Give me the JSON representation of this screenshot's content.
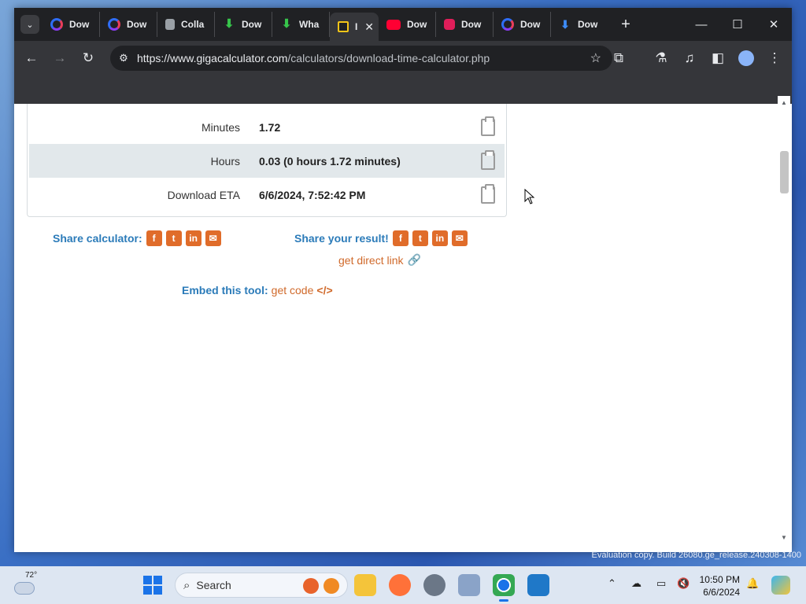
{
  "browser": {
    "tabs": [
      {
        "title": "Dow",
        "icon": "ring-logo-icon"
      },
      {
        "title": "Dow",
        "icon": "ring-logo-icon"
      },
      {
        "title": "Colla",
        "icon": "collab-icon"
      },
      {
        "title": "Dow",
        "icon": "download-arrow-icon"
      },
      {
        "title": "Wha",
        "icon": "download-arrow-icon"
      },
      {
        "title": "I",
        "icon": "gigacalculator-icon",
        "active": true
      },
      {
        "title": "Dow",
        "icon": "youtube-icon"
      },
      {
        "title": "Dow",
        "icon": "slack-icon"
      },
      {
        "title": "Dow",
        "icon": "ring-logo-icon"
      },
      {
        "title": "Dow",
        "icon": "blue-download-icon"
      }
    ],
    "tab_close_glyph": "✕",
    "new_tab_glyph": "+",
    "url_host": "https://www.gigacalculator.com",
    "url_path": "/calculators/download-time-calculator.php"
  },
  "results": {
    "rows": [
      {
        "label": "Minutes",
        "value": "1.72"
      },
      {
        "label": "Hours",
        "value": "0.03 (0 hours 1.72 minutes)"
      },
      {
        "label": "Download ETA",
        "value": "6/6/2024, 7:52:42 PM"
      }
    ]
  },
  "share": {
    "calculator_label": "Share calculator:",
    "result_label": "Share your result!",
    "direct_link": "get direct link",
    "embed_label": "Embed this tool:",
    "embed_link": "get code",
    "embed_glyph": "</>"
  },
  "desktop": {
    "watermark": "Evaluation copy. Build 26080.ge_release.240308-1400"
  },
  "taskbar": {
    "weather_temp": "72°",
    "search_placeholder": "Search",
    "time": "10:50 PM",
    "date": "6/6/2024",
    "colors": {
      "accent": "#1a73e8",
      "chrome_dark": "#202124",
      "link_orange": "#d0692a",
      "link_blue": "#2b7bb9"
    }
  }
}
